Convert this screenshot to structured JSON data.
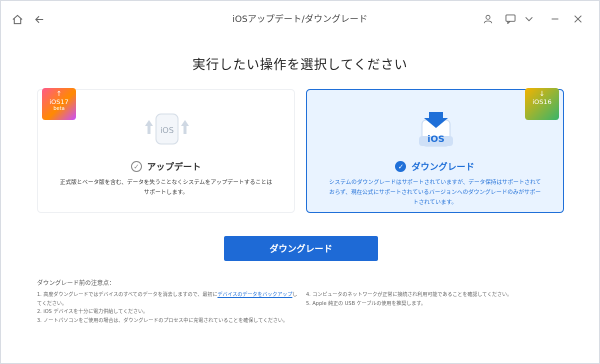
{
  "window": {
    "title": "iOSアップデート/ダウングレード"
  },
  "heading": "実行したい操作を選択してください",
  "cards": {
    "upgrade": {
      "title": "アップデート",
      "selected": false,
      "badge": {
        "label": "iOS17",
        "sub": "beta"
      },
      "icon_label": "iOS",
      "description": "正式版とベータ版を含む、データを失うことなくシステムをアップデートすることはサポートします。"
    },
    "downgrade": {
      "title": "ダウングレード",
      "selected": true,
      "badge": {
        "label": "iOS16"
      },
      "icon_label": "iOS",
      "description": "システムのダウングレードはサポートされていますが、データ保持はサポートされておらず、現在公式にサポートされているバージョンへのダウングレードのみがサポートされています。"
    }
  },
  "primary_button": "ダウングレード",
  "notes": {
    "title": "ダウングレード前の注意点：",
    "left": [
      "1. 高度ダウングレードではデバイスのすべてのデータを消去しますので、最初に",
      "デバイスのデータをバックアップ",
      "してください。",
      "2. iOS デバイスを十分に電力供給してください。",
      "3. ノートパソコンをご使用の場合は、ダウングレードのプロセス中に充電されていることを確保してください。"
    ],
    "right": [
      "4. コンピュータのネットワークが正常に接続され利用可能であることを確認してください。",
      "5. Apple 純正の USB ケーブルの使用を推奨します。"
    ]
  },
  "colors": {
    "accent": "#1e6ad6",
    "selected_bg": "#e9f3ff"
  }
}
